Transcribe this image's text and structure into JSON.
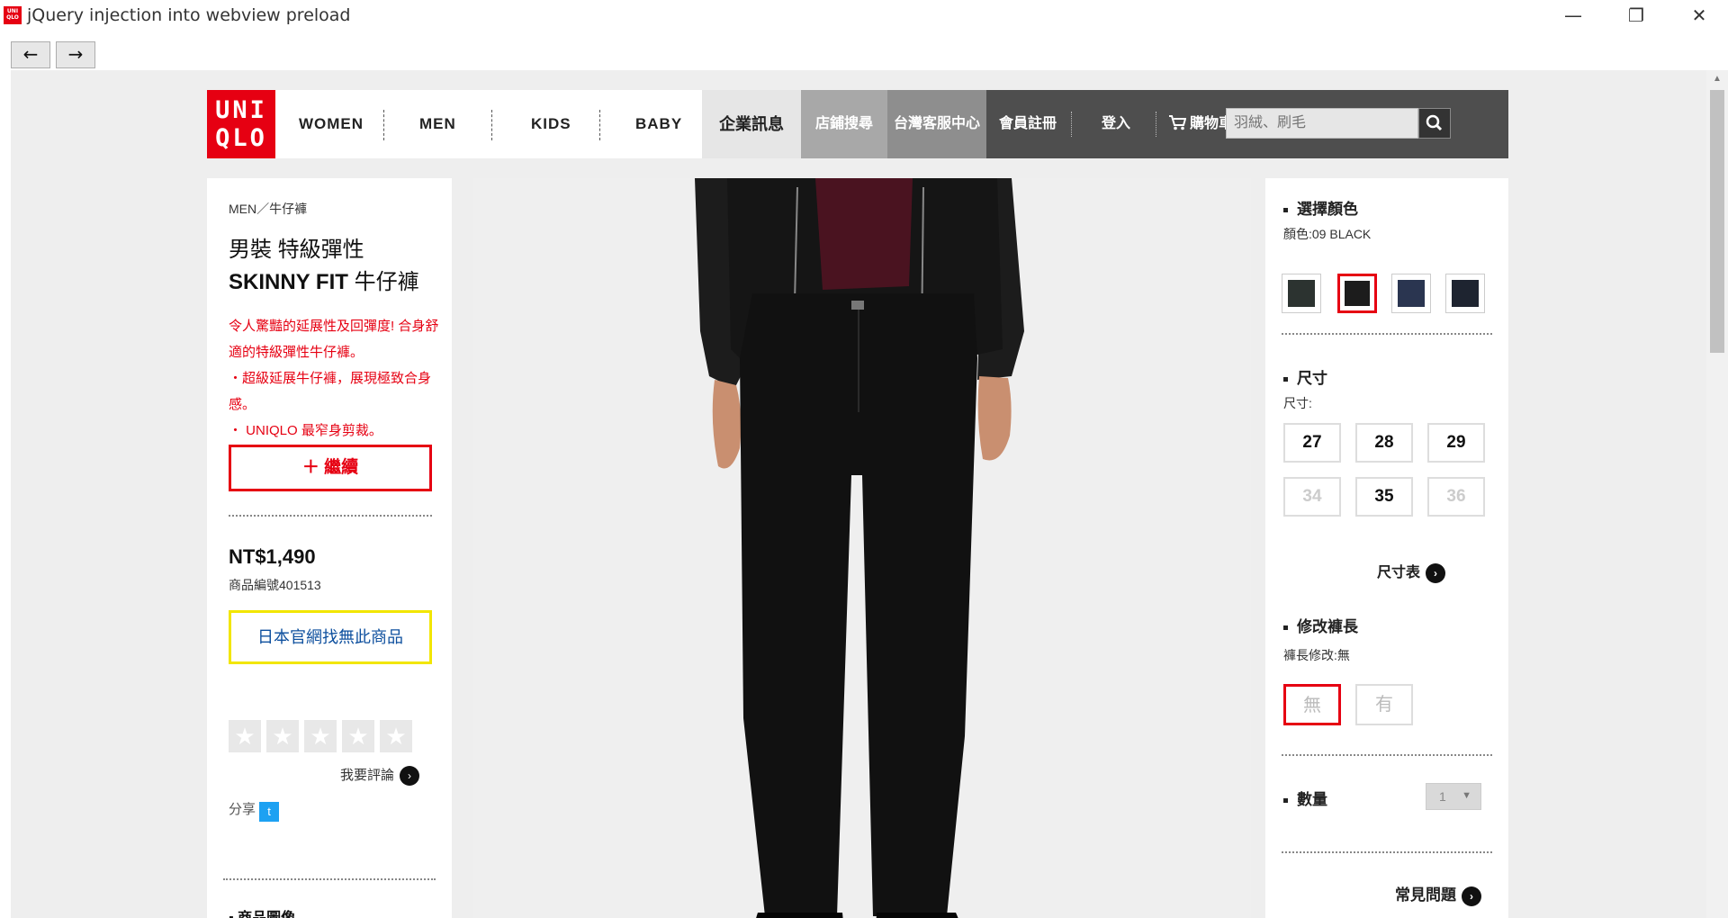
{
  "window": {
    "app_icon_text": "UNI QLO",
    "title": "jQuery injection into webview preload",
    "minimize": "—",
    "restore": "❐",
    "close": "✕"
  },
  "nav": {
    "back": "←",
    "forward": "→"
  },
  "header": {
    "logo_line1": "UNI",
    "logo_line2": "QLO",
    "categories": [
      "WOMEN",
      "MEN",
      "KIDS",
      "BABY"
    ],
    "corp_info": "企業訊息",
    "store_search": "店鋪搜尋",
    "customer_service": "台灣客服中心",
    "register": "會員註冊",
    "login": "登入",
    "cart": "購物車",
    "search_placeholder": "羽絨、刷毛"
  },
  "product": {
    "breadcrumb": "MEN／牛仔褲",
    "title_line1": "男裝 特級彈性",
    "title_line2_bold": "SKINNY FIT",
    "title_line2_rest": " 牛仔褲",
    "description": [
      "令人驚豔的延展性及回彈度! 合身舒適的特級彈性牛仔褲。",
      "・超級延展牛仔褲，展現極致合身感。",
      "・ UNIQLO 最窄身剪裁。"
    ],
    "more_label": "繼續",
    "price": "NT$1,490",
    "item_code": "商品編號401513",
    "jp_notice": "日本官網找無此商品",
    "stars": [
      "★",
      "★",
      "★",
      "★",
      "★"
    ],
    "review_label": "我要評論",
    "share_label": "分享",
    "twitter_glyph": "t",
    "images_heading": "商品圖像"
  },
  "options": {
    "color_heading": "選擇顏色",
    "color_selected": "顏色:09 BLACK",
    "colors": [
      "#2c3330",
      "#1c1c1c",
      "#2a3550",
      "#1e2430"
    ],
    "selected_color_index": 1,
    "size_heading": "尺寸",
    "size_selected": "尺寸:",
    "sizes": [
      "27",
      "28",
      "29",
      "34",
      "35",
      "36"
    ],
    "size_chart": "尺寸表",
    "hem_heading": "修改褲長",
    "hem_selected": "褲長修改:無",
    "hem_options": [
      "無",
      "有"
    ],
    "quantity_heading": "數量",
    "quantity_value": "1",
    "faq": "常見問題"
  }
}
